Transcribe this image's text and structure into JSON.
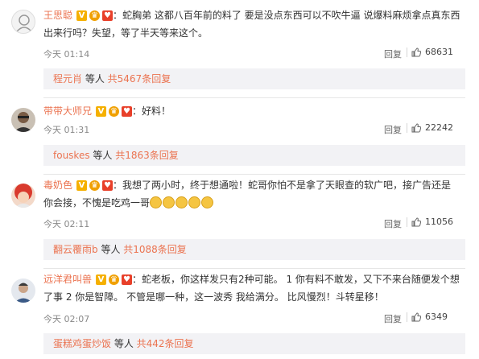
{
  "colors": {
    "name": "#eb7350",
    "badge_v": "#f5b000",
    "badge_red": "#e8402a",
    "subbox_bg": "#f2f2f5"
  },
  "comments": [
    {
      "name": "王思聪",
      "text_line1": "：蛇胸弟 这都八百年前的料了 要是没点东西可以不吹牛逼 说爆料麻烦拿点真东西",
      "text_line2": "出来行吗？失望，等了半天等来这个。",
      "time": "今天 01:14",
      "reply_label": "回复",
      "likes": "68631",
      "sub_name": "程元肖",
      "sub_mid": " 等人 ",
      "sub_count": "共5467条回复",
      "avatar_icon": "cartoon-avatar-icon"
    },
    {
      "name": "带带大师兄",
      "text_line1": "：好料！",
      "time": "今天 01:31",
      "reply_label": "回复",
      "likes": "22242",
      "sub_name": "fouskes",
      "sub_mid": " 等人 ",
      "sub_count": "共1863条回复",
      "avatar_icon": "person-avatar-icon"
    },
    {
      "name": "毒奶色",
      "text_line1": "：我想了两小时，终于想通啦！蛇哥你怕不是拿了天眼查的软广吧，接广告还是",
      "text_line2": "你会接，不愧是吃鸡一哥",
      "time": "今天 02:11",
      "reply_label": "回复",
      "likes": "11056",
      "sub_name": "翻云覆雨b",
      "sub_mid": " 等人 ",
      "sub_count": "共1088条回复",
      "avatar_icon": "red-hair-avatar-icon"
    },
    {
      "name": "远洋君叫兽",
      "text_line1": "：蛇老板，你这样发只有2种可能。 1 你有料不敢发，又下不来台随便发个想",
      "text_line2": "了事 2 你是智障。 不管是哪一种，这一波秀 我给满分。 比风慢烈！斗转星移！",
      "time": "今天 02:07",
      "reply_label": "回复",
      "likes": "6349",
      "sub_name": "蛋糕鸡蛋炒饭",
      "sub_mid": " 等人 ",
      "sub_count": "共442条回复",
      "avatar_icon": "person-avatar-icon"
    }
  ]
}
